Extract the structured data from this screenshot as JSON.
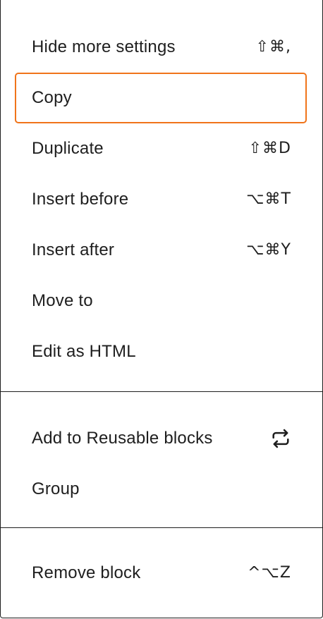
{
  "menu": {
    "group1": [
      {
        "label": "Hide more settings",
        "shortcut": "⇧⌘,"
      },
      {
        "label": "Copy",
        "shortcut": "",
        "focused": true
      },
      {
        "label": "Duplicate",
        "shortcut": "⇧⌘D"
      },
      {
        "label": "Insert before",
        "shortcut": "⌥⌘T"
      },
      {
        "label": "Insert after",
        "shortcut": "⌥⌘Y"
      },
      {
        "label": "Move to",
        "shortcut": ""
      },
      {
        "label": "Edit as HTML",
        "shortcut": ""
      }
    ],
    "group2": [
      {
        "label": "Add to Reusable blocks",
        "icon": "reusable-block-icon"
      },
      {
        "label": "Group",
        "shortcut": ""
      }
    ],
    "group3": [
      {
        "label": "Remove block",
        "shortcut": "^⌥Z"
      }
    ]
  },
  "colors": {
    "focus_ring": "#f0741a",
    "text": "#1e1e1e",
    "border": "#1e1e1e",
    "background": "#ffffff"
  }
}
